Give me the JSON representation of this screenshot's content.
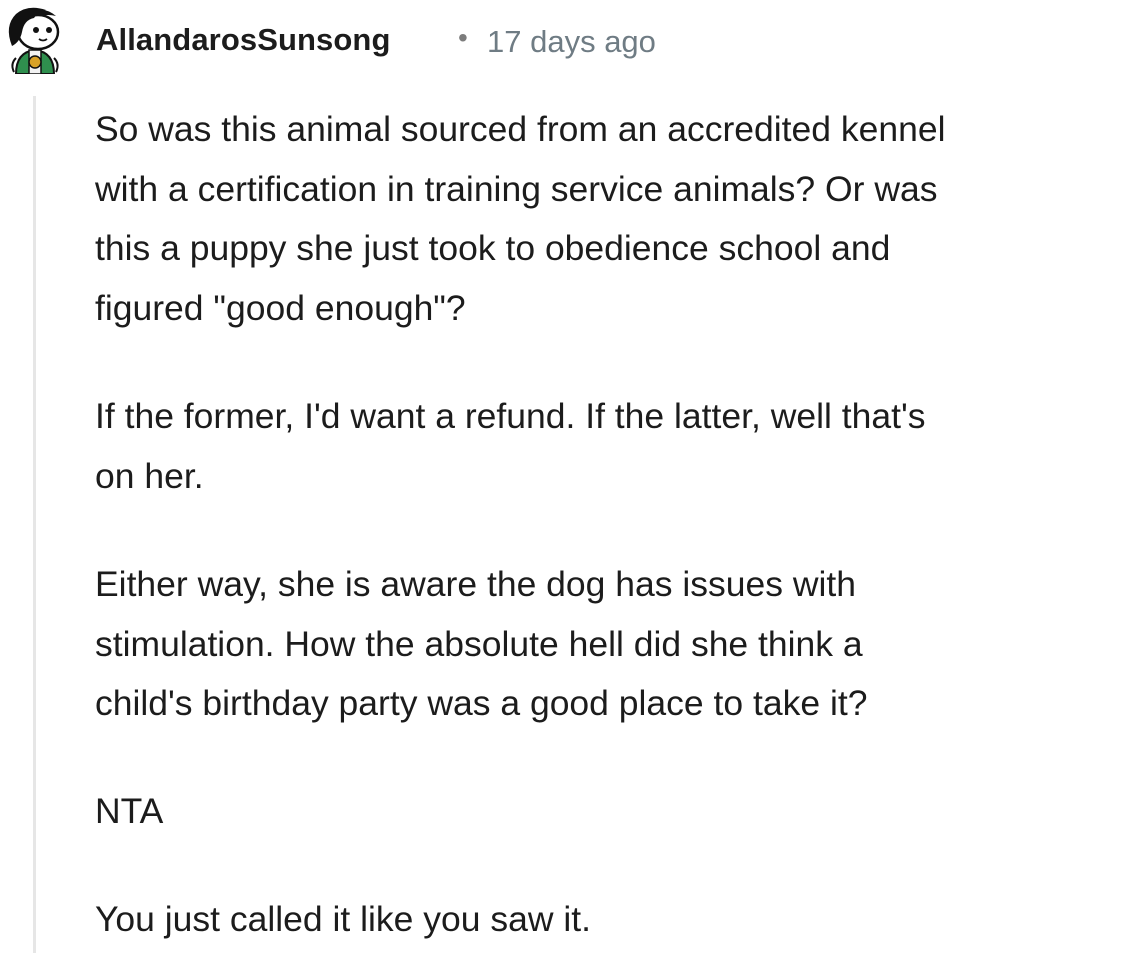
{
  "comment": {
    "username": "AllandarosSunsong",
    "separator": "•",
    "timestamp": "17 days ago",
    "paragraphs": [
      {
        "lines": [
          "So was this animal sourced from an accredited kennel",
          "with a certification in training service animals? Or was",
          "this a puppy she just took to obedience school and",
          "figured \"good enough\"?"
        ]
      },
      {
        "lines": [
          "If the former, I'd want a refund. If the latter, well that's",
          "on her."
        ]
      },
      {
        "lines": [
          "Either way, she is aware the dog has issues with",
          "stimulation. How the absolute hell did she think a",
          "child's birthday party was a good place to take it?"
        ]
      },
      {
        "lines": [
          "NTA"
        ]
      },
      {
        "lines": [
          "You just called it like you saw it."
        ]
      }
    ]
  },
  "icons": {
    "avatar": "snoo-avatar-icon"
  },
  "colors": {
    "text": "#1c1c1c",
    "meta": "#6f7c84",
    "thread_line": "#e6e6e6",
    "avatar_hair": "#111111",
    "avatar_shirt": "#2f8f4e",
    "avatar_badge": "#d9a227"
  }
}
